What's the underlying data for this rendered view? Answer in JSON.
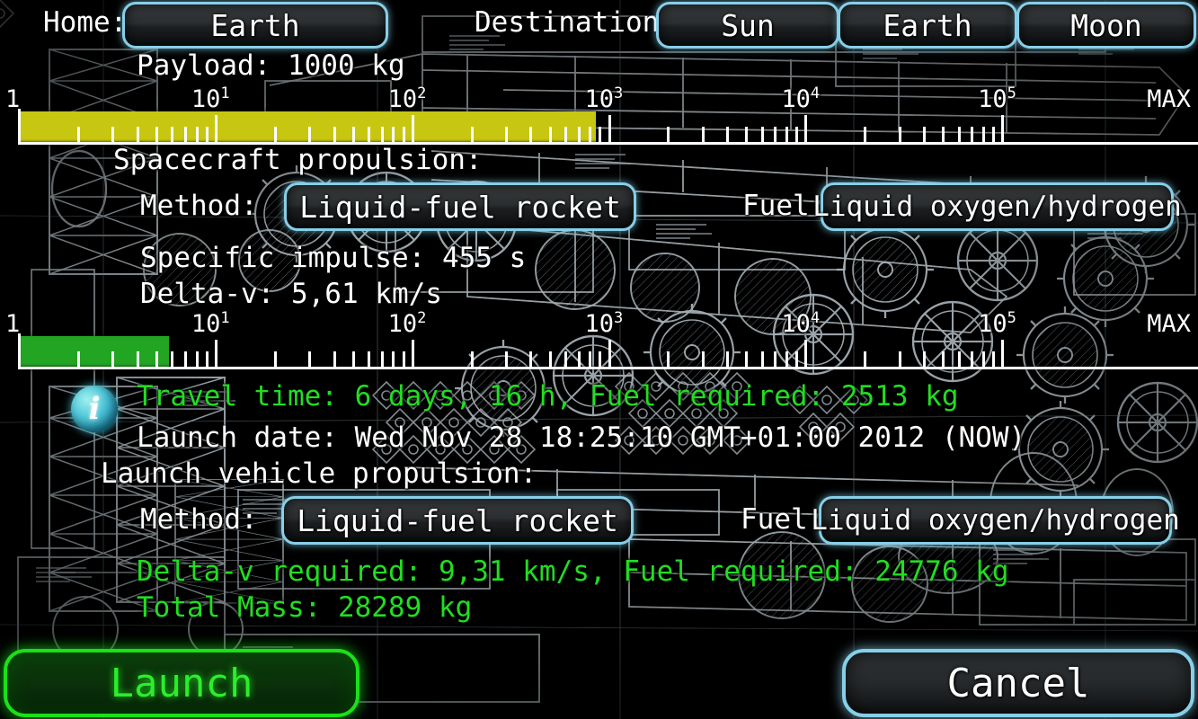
{
  "header": {
    "home_label": "Home:",
    "home_value": "Earth",
    "destination_label": "Destination:",
    "destinations": [
      {
        "label": "Sun"
      },
      {
        "label": "Earth"
      },
      {
        "label": "Moon"
      }
    ]
  },
  "payload": {
    "text": "Payload: 1000 kg",
    "slider": {
      "axis_labels": [
        "1",
        "10¹",
        "10²",
        "10³",
        "10⁴",
        "10⁵",
        "MAX"
      ],
      "fill_color": "#c7c712",
      "fill_percent": 49,
      "value": 1000,
      "unit": "kg"
    }
  },
  "spacecraft": {
    "section_title": "Spacecraft propulsion:",
    "method_label": "Method:",
    "method_value": "Liquid-fuel rocket",
    "fuel_label": "Fuel:",
    "fuel_value": "Liquid oxygen/hydrogen",
    "specific_impulse": "Specific impulse: 455 s",
    "delta_v": "Delta-v: 5,61 km/s",
    "slider": {
      "axis_labels": [
        "1",
        "10¹",
        "10²",
        "10³",
        "10⁴",
        "10⁵",
        "MAX"
      ],
      "fill_color": "#22a522",
      "fill_percent": 12.8,
      "value": 5.61,
      "unit": "km/s"
    }
  },
  "info": {
    "icon": "info-icon",
    "travel_line": "Travel time: 6 days, 16 h, Fuel required: 2513 kg",
    "launch_date": "Launch date: Wed Nov 28 18:25:10 GMT+01:00 2012 (NOW)"
  },
  "launch_vehicle": {
    "section_title": "Launch vehicle propulsion:",
    "method_label": "Method:",
    "method_value": "Liquid-fuel rocket",
    "fuel_label": "Fuel:",
    "fuel_value": "Liquid oxygen/hydrogen",
    "delta_v_required": "Delta-v required: 9,31 km/s, Fuel required: 24776 kg",
    "total_mass": "Total Mass: 28289 kg"
  },
  "actions": {
    "launch_label": "Launch",
    "cancel_label": "Cancel"
  },
  "colors": {
    "accent_blue": "#86cfe8",
    "accent_green": "#22dd22",
    "payload_bar": "#c7c712",
    "deltav_bar": "#22a522",
    "text": "#ffffff",
    "background": "#000000"
  }
}
